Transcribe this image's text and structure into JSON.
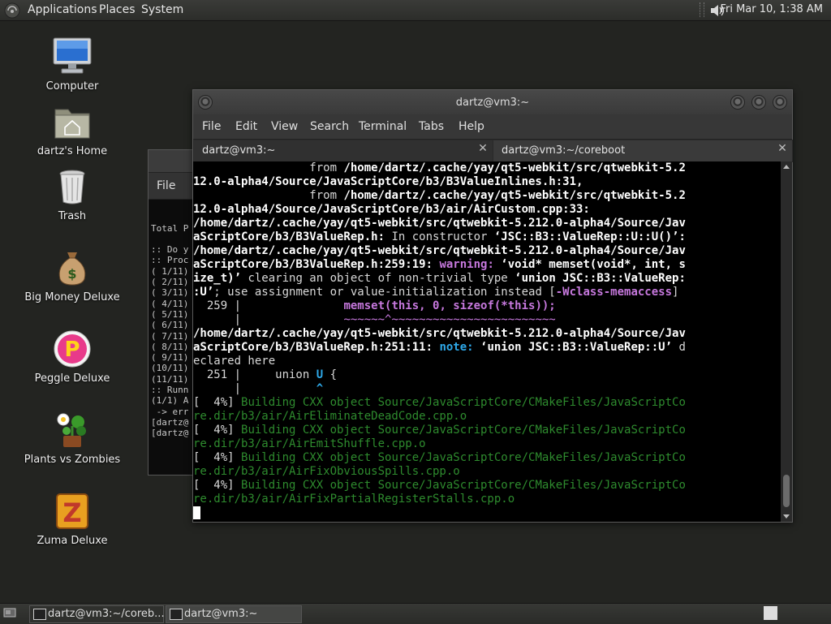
{
  "top_panel": {
    "menus": [
      "Applications",
      "Places",
      "System"
    ],
    "clock": "Fri Mar 10, 1:38 AM",
    "volume_icon": "speaker-icon",
    "logo_icon": "gnome-foot-icon"
  },
  "desktop_icons": [
    {
      "label": "Computer",
      "icon": "computer-icon"
    },
    {
      "label": "dartz's Home",
      "icon": "home-folder-icon"
    },
    {
      "label": "Trash",
      "icon": "trash-icon"
    },
    {
      "label": "Big Money Deluxe",
      "icon": "money-bag-icon"
    },
    {
      "label": "Peggle Deluxe",
      "icon": "peggle-icon"
    },
    {
      "label": "Plants vs Zombies",
      "icon": "plants-icon"
    },
    {
      "label": "Zuma Deluxe",
      "icon": "zuma-icon"
    }
  ],
  "back_terminal": {
    "menu_label": "File",
    "lines": [
      "",
      "",
      "Total P",
      "",
      ":: Do y",
      ":: Proc",
      "( 1/11)",
      "( 2/11)",
      "( 3/11)",
      "( 4/11)",
      "( 5/11)",
      "( 6/11)",
      "( 7/11)",
      "( 8/11)",
      "( 9/11)",
      "(10/11)",
      "(11/11)",
      ":: Runn",
      "(1/1) A",
      " -> err",
      "[dartz@",
      "[dartz@"
    ]
  },
  "main_terminal": {
    "title": "dartz@vm3:~",
    "menus": [
      "File",
      "Edit",
      "View",
      "Search",
      "Terminal",
      "Tabs",
      "Help"
    ],
    "tabs": [
      {
        "label": "dartz@vm3:~",
        "active": true
      },
      {
        "label": "dartz@vm3:~/coreboot",
        "active": false
      }
    ],
    "output": {
      "l1a": "                 from ",
      "l1b": "/home/dartz/.cache/yay/qt5-webkit/src/qtwebkit-5.2",
      "l2": "12.0-alpha4/Source/JavaScriptCore/b3/B3ValueInlines.h:31,",
      "l3a": "                 from ",
      "l3b": "/home/dartz/.cache/yay/qt5-webkit/src/qtwebkit-5.2",
      "l4": "12.0-alpha4/Source/JavaScriptCore/b3/air/AirCustom.cpp:33:",
      "l5": "/home/dartz/.cache/yay/qt5-webkit/src/qtwebkit-5.212.0-alpha4/Source/Jav",
      "l6a": "aScriptCore/b3/B3ValueRep.h:",
      "l6b": " In constructor ",
      "l6c": "‘JSC::B3::ValueRep::U::U()’:",
      "l7": "/home/dartz/.cache/yay/qt5-webkit/src/qtwebkit-5.212.0-alpha4/Source/Jav",
      "l8a": "aScriptCore/b3/B3ValueRep.h:259:19: ",
      "l8b": "warning: ",
      "l8c": "‘void* memset(void*, int, s",
      "l9a": "ize_t)’",
      "l9b": " clearing an object of non-trivial type ",
      "l9c": "‘union JSC::B3::ValueRep:",
      "l10a": ":U’",
      "l10b": "; use assignment or value-initialization instead [",
      "l10c": "-Wclass-memaccess",
      "l10d": "]",
      "l11a": "  259 |               ",
      "l11b": "memset(this, 0, sizeof(*this));",
      "l12a": "      |               ",
      "l12b": "~~~~~~^~~~~~~~~~~~~~~~~~~~~~~~~",
      "l13": "/home/dartz/.cache/yay/qt5-webkit/src/qtwebkit-5.212.0-alpha4/Source/Jav",
      "l14a": "aScriptCore/b3/B3ValueRep.h:251:11: ",
      "l14b": "note: ",
      "l14c": "‘union JSC::B3::ValueRep::U’",
      "l14d": " d",
      "l15": "eclared here",
      "l16a": "  251 |     union ",
      "l16b": "U",
      "l16c": " {",
      "l17a": "      |           ",
      "l17b": "^",
      "build": [
        {
          "prefix": "[  4%] ",
          "a": "Building CXX object Source/JavaScriptCore/CMakeFiles/JavaScriptCo",
          "b": "re.dir/b3/air/AirEliminateDeadCode.cpp.o"
        },
        {
          "prefix": "[  4%] ",
          "a": "Building CXX object Source/JavaScriptCore/CMakeFiles/JavaScriptCo",
          "b": "re.dir/b3/air/AirEmitShuffle.cpp.o"
        },
        {
          "prefix": "[  4%] ",
          "a": "Building CXX object Source/JavaScriptCore/CMakeFiles/JavaScriptCo",
          "b": "re.dir/b3/air/AirFixObviousSpills.cpp.o"
        },
        {
          "prefix": "[  4%] ",
          "a": "Building CXX object Source/JavaScriptCore/CMakeFiles/JavaScriptCo",
          "b": "re.dir/b3/air/AirFixPartialRegisterStalls.cpp.o"
        }
      ]
    }
  },
  "bottom_panel": {
    "tasks": [
      {
        "label": "dartz@vm3:~/coreb...",
        "active": false
      },
      {
        "label": "dartz@vm3:~",
        "active": true
      }
    ]
  },
  "colors": {
    "desktop_bg": "#232421",
    "warning": "#c678dd",
    "note": "#2ea8e8",
    "build_green": "#2e8b2e"
  }
}
